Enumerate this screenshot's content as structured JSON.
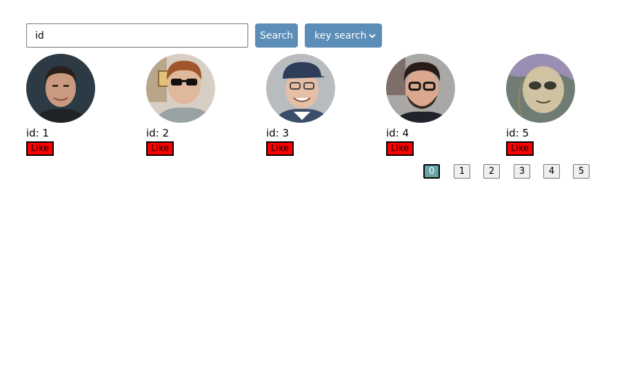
{
  "search": {
    "value": "id",
    "button_label": "Search",
    "mode_selected": "key search"
  },
  "users": [
    {
      "id_label": "id: 1",
      "like_label": "Like"
    },
    {
      "id_label": "id: 2",
      "like_label": "Like"
    },
    {
      "id_label": "id: 3",
      "like_label": "Like"
    },
    {
      "id_label": "id: 4",
      "like_label": "Like"
    },
    {
      "id_label": "id: 5",
      "like_label": "Like"
    }
  ],
  "pagination": {
    "pages": [
      "0",
      "1",
      "2",
      "3",
      "4",
      "5"
    ],
    "active": "0"
  },
  "colors": {
    "accent_blue": "#5b8db8",
    "like_red": "#ff0000",
    "active_page": "#6aa3a8"
  }
}
